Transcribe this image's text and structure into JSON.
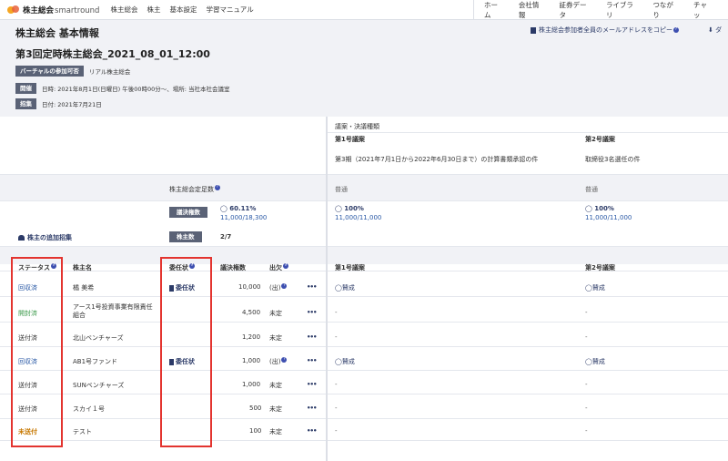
{
  "nav": {
    "brand": "株主総会",
    "brand_sub": "smartround",
    "left": [
      "株主総会",
      "株主",
      "基本設定",
      "学習マニュアル"
    ],
    "right": [
      "ホーム",
      "会社情報",
      "証券データ",
      "ライブラリ",
      "つながり",
      "チャッ"
    ]
  },
  "header": {
    "title": "株主総会 基本情報",
    "meeting_name": "第3回定時株主総会_2021_08_01_12:00",
    "copy_emails": "株主総会参加者全員のメールアドレスをコピー",
    "download": "ダ"
  },
  "info": {
    "virtual_tag": "バーチャルの参加可否",
    "virtual_val": "リアル株主総会",
    "held_tag": "開催",
    "held_val": "日時: 2021年8月1日(日曜日) 午後00時00分〜、場所: 当社本社会議室",
    "convene_tag": "招集",
    "convene_val": "日付: 2021年7月21日"
  },
  "table": {
    "agenda_heading": "議案・決議種類",
    "agendas": [
      {
        "label": "第1号議案",
        "desc": "第3期（2021年7月1日から2022年6月30日まで）の計算書類承認の件",
        "type": "普通",
        "pct": "◯ 60.11%",
        "approve_pct": "◯ 100%",
        "approve_ratio": "11,000/11,000"
      },
      {
        "label": "第2号議案",
        "desc": "取締役3名選任の件",
        "type": "普通",
        "approve_pct": "◯ 100%",
        "approve_ratio": "11,000/11,000"
      }
    ],
    "quorum_label": "株主総会定足数",
    "vote_rights_pill": "議決権数",
    "quorum_pct": "◯ 60.11%",
    "quorum_ratio": "11,000/18,300",
    "shareholder_count_pill": "株主数",
    "shareholder_count": "2/7",
    "add_convene": "株主の追加招集",
    "columns": {
      "status": "ステータス",
      "name": "株主名",
      "proxy": "委任状",
      "votes": "議決権数",
      "attendance": "出欠",
      "agenda1": "第1号議案",
      "agenda2": "第2号議案"
    },
    "rows": [
      {
        "status": "回収済",
        "status_color": "blue",
        "name": "橘 美希",
        "proxy": "委任状",
        "votes": "10,000",
        "attendance": "(出)",
        "a1": "◯賛成",
        "a2": "◯賛成"
      },
      {
        "status": "開封済",
        "status_color": "green",
        "name": "アース1号投資事業有限責任組合",
        "proxy": "",
        "votes": "4,500",
        "attendance": "未定",
        "a1": "-",
        "a2": "-"
      },
      {
        "status": "送付済",
        "status_color": "grey",
        "name": "北山ベンチャーズ",
        "proxy": "",
        "votes": "1,200",
        "attendance": "未定",
        "a1": "-",
        "a2": "-"
      },
      {
        "status": "回収済",
        "status_color": "blue",
        "name": "AB1号ファンド",
        "proxy": "委任状",
        "votes": "1,000",
        "attendance": "(出)",
        "a1": "◯賛成",
        "a2": "◯賛成"
      },
      {
        "status": "送付済",
        "status_color": "grey",
        "name": "SUNベンチャーズ",
        "proxy": "",
        "votes": "1,000",
        "attendance": "未定",
        "a1": "-",
        "a2": "-"
      },
      {
        "status": "送付済",
        "status_color": "grey",
        "name": "スカイ１号",
        "proxy": "",
        "votes": "500",
        "attendance": "未定",
        "a1": "-",
        "a2": "-"
      },
      {
        "status": "未送付",
        "status_color": "orange",
        "name": "テスト",
        "proxy": "",
        "votes": "100",
        "attendance": "未定",
        "a1": "-",
        "a2": "-"
      }
    ],
    "more_icon": "•••",
    "help_icon": "?"
  }
}
